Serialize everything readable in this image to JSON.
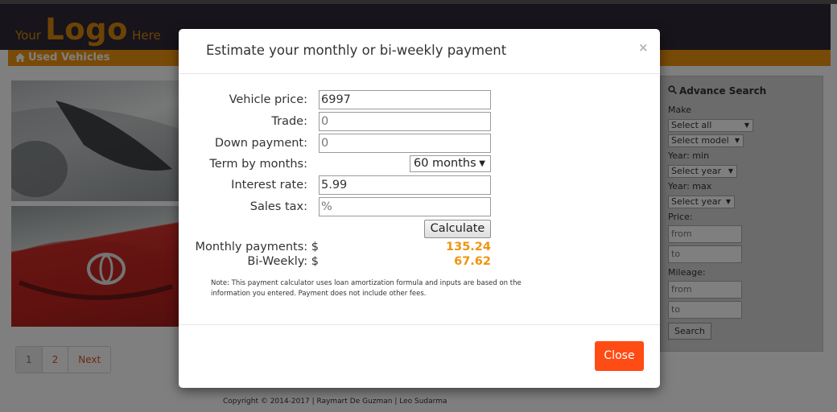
{
  "header": {
    "logo_prefix": "Your",
    "logo_main": "Logo",
    "logo_suffix": "Here"
  },
  "nav": {
    "used_vehicles": "Used Vehicles"
  },
  "pagination": {
    "page1": "1",
    "page2": "2",
    "next": "Next"
  },
  "advance_search": {
    "title": "Advance Search",
    "make_label": "Make",
    "make_value": "Select all",
    "model_value": "Select model",
    "year_min_label": "Year: min",
    "year_min_value": "Select year",
    "year_max_label": "Year: max",
    "year_max_value": "Select year",
    "price_label": "Price:",
    "price_from": "from",
    "price_to": "to",
    "mileage_label": "Mileage:",
    "mileage_from": "from",
    "mileage_to": "to",
    "search_button": "Search"
  },
  "footer": {
    "copyright": "Copyright © 2014-2017 | Raymart De Guzman | Leo Sudarma"
  },
  "modal": {
    "title": "Estimate your monthly or bi-weekly payment",
    "close_x": "×",
    "vehicle_price_label": "Vehicle price:",
    "vehicle_price_value": "6997",
    "trade_label": "Trade:",
    "trade_value": "0",
    "down_payment_label": "Down payment:",
    "down_payment_value": "0",
    "term_label": "Term by months:",
    "term_value": "60 months",
    "interest_label": "Interest rate:",
    "interest_value": "5.99",
    "sales_tax_label": "Sales tax:",
    "sales_tax_placeholder": "%",
    "calculate_button": "Calculate",
    "monthly_label": "Monthly payments: $",
    "monthly_value": "135.24",
    "biweekly_label": "Bi-Weekly: $",
    "biweekly_value": "67.62",
    "note": "Note: This payment calculator uses loan amortization formula and inputs are based on the information you entered. Payment does not include other fees.",
    "close_button": "Close"
  },
  "colors": {
    "accent": "#f0940f",
    "header_bg": "#2e2937",
    "close_button": "#ff4b14"
  }
}
